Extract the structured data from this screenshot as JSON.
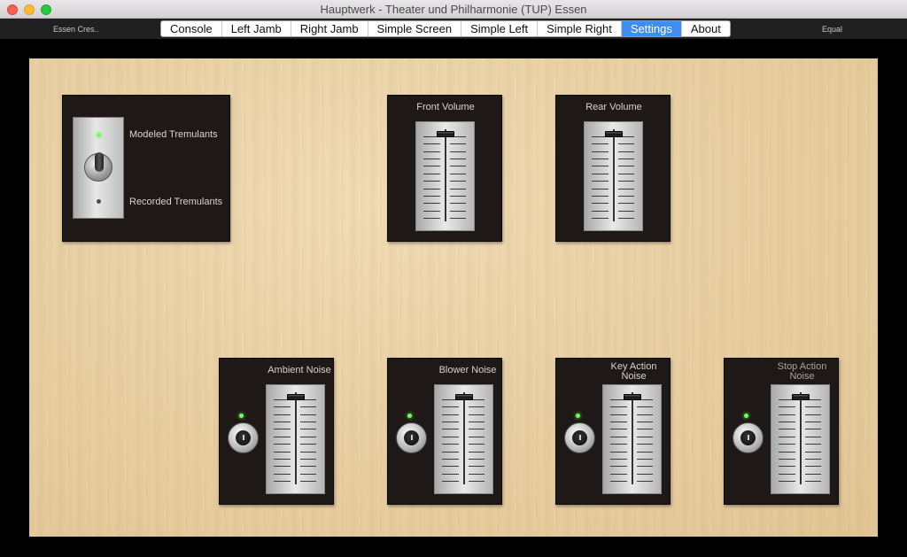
{
  "window": {
    "title": "Hauptwerk - Theater und Philharmonie (TUP) Essen"
  },
  "toolbar": {
    "left_label": "Essen Cres..",
    "right_label": "Equal",
    "tabs": [
      {
        "label": "Console",
        "active": false
      },
      {
        "label": "Left Jamb",
        "active": false
      },
      {
        "label": "Right Jamb",
        "active": false
      },
      {
        "label": "Simple Screen",
        "active": false
      },
      {
        "label": "Simple Left",
        "active": false
      },
      {
        "label": "Simple Right",
        "active": false
      },
      {
        "label": "Settings",
        "active": true
      },
      {
        "label": "About",
        "active": false
      }
    ]
  },
  "tremulants": {
    "top_label": "Modeled Tremulants",
    "bottom_label": "Recorded Tremulants"
  },
  "volumes": {
    "front": {
      "label": "Front Volume",
      "level": 1.0
    },
    "rear": {
      "label": "Rear Volume",
      "level": 1.0
    }
  },
  "noises": {
    "ambient": {
      "label": "Ambient Noise",
      "level": 1.0,
      "enabled": true
    },
    "blower": {
      "label": "Blower Noise",
      "level": 1.0,
      "enabled": true
    },
    "key_action": {
      "label": "Key Action\nNoise",
      "level": 1.0,
      "enabled": true
    },
    "stop_action": {
      "label": "Stop Action\nNoise",
      "level": 1.0,
      "enabled": true
    }
  },
  "colors": {
    "active_tab": "#3d8ef0",
    "led_on": "#6cff5a",
    "panel": "#1e1816",
    "wood": "#ead2a6"
  }
}
